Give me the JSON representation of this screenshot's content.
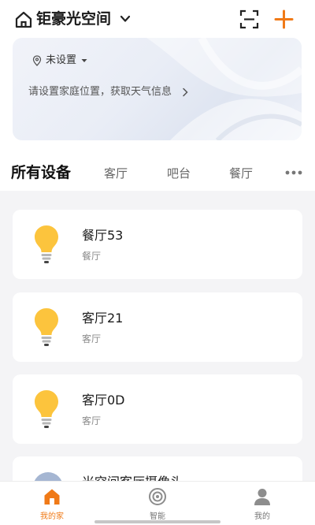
{
  "colors": {
    "accent": "#f07a17",
    "bulb": "#fcc43d",
    "background": "#f4f4f6",
    "card": "#ffffff"
  },
  "header": {
    "home_name": "钜豪光空间",
    "icons": [
      "home-icon",
      "chevron-down-icon",
      "scan-icon",
      "add-icon"
    ]
  },
  "weather": {
    "location_label": "未设置",
    "tip": "请设置家庭位置，获取天气信息"
  },
  "devices_section": {
    "title": "所有设备",
    "rooms": [
      "客厅",
      "吧台",
      "餐厅"
    ]
  },
  "devices": [
    {
      "name": "餐厅53",
      "room": "餐厅",
      "icon": "bulb-icon"
    },
    {
      "name": "客厅21",
      "room": "客厅",
      "icon": "bulb-icon"
    },
    {
      "name": "客厅0D",
      "room": "客厅",
      "icon": "bulb-icon"
    },
    {
      "name": "米空间客厅摄像头",
      "room": "",
      "icon": "camera-icon"
    }
  ],
  "tabbar": {
    "items": [
      {
        "label": "我的家",
        "icon": "home-tab-icon",
        "active": true
      },
      {
        "label": "智能",
        "icon": "smart-tab-icon",
        "active": false
      },
      {
        "label": "我的",
        "icon": "profile-tab-icon",
        "active": false
      }
    ]
  }
}
